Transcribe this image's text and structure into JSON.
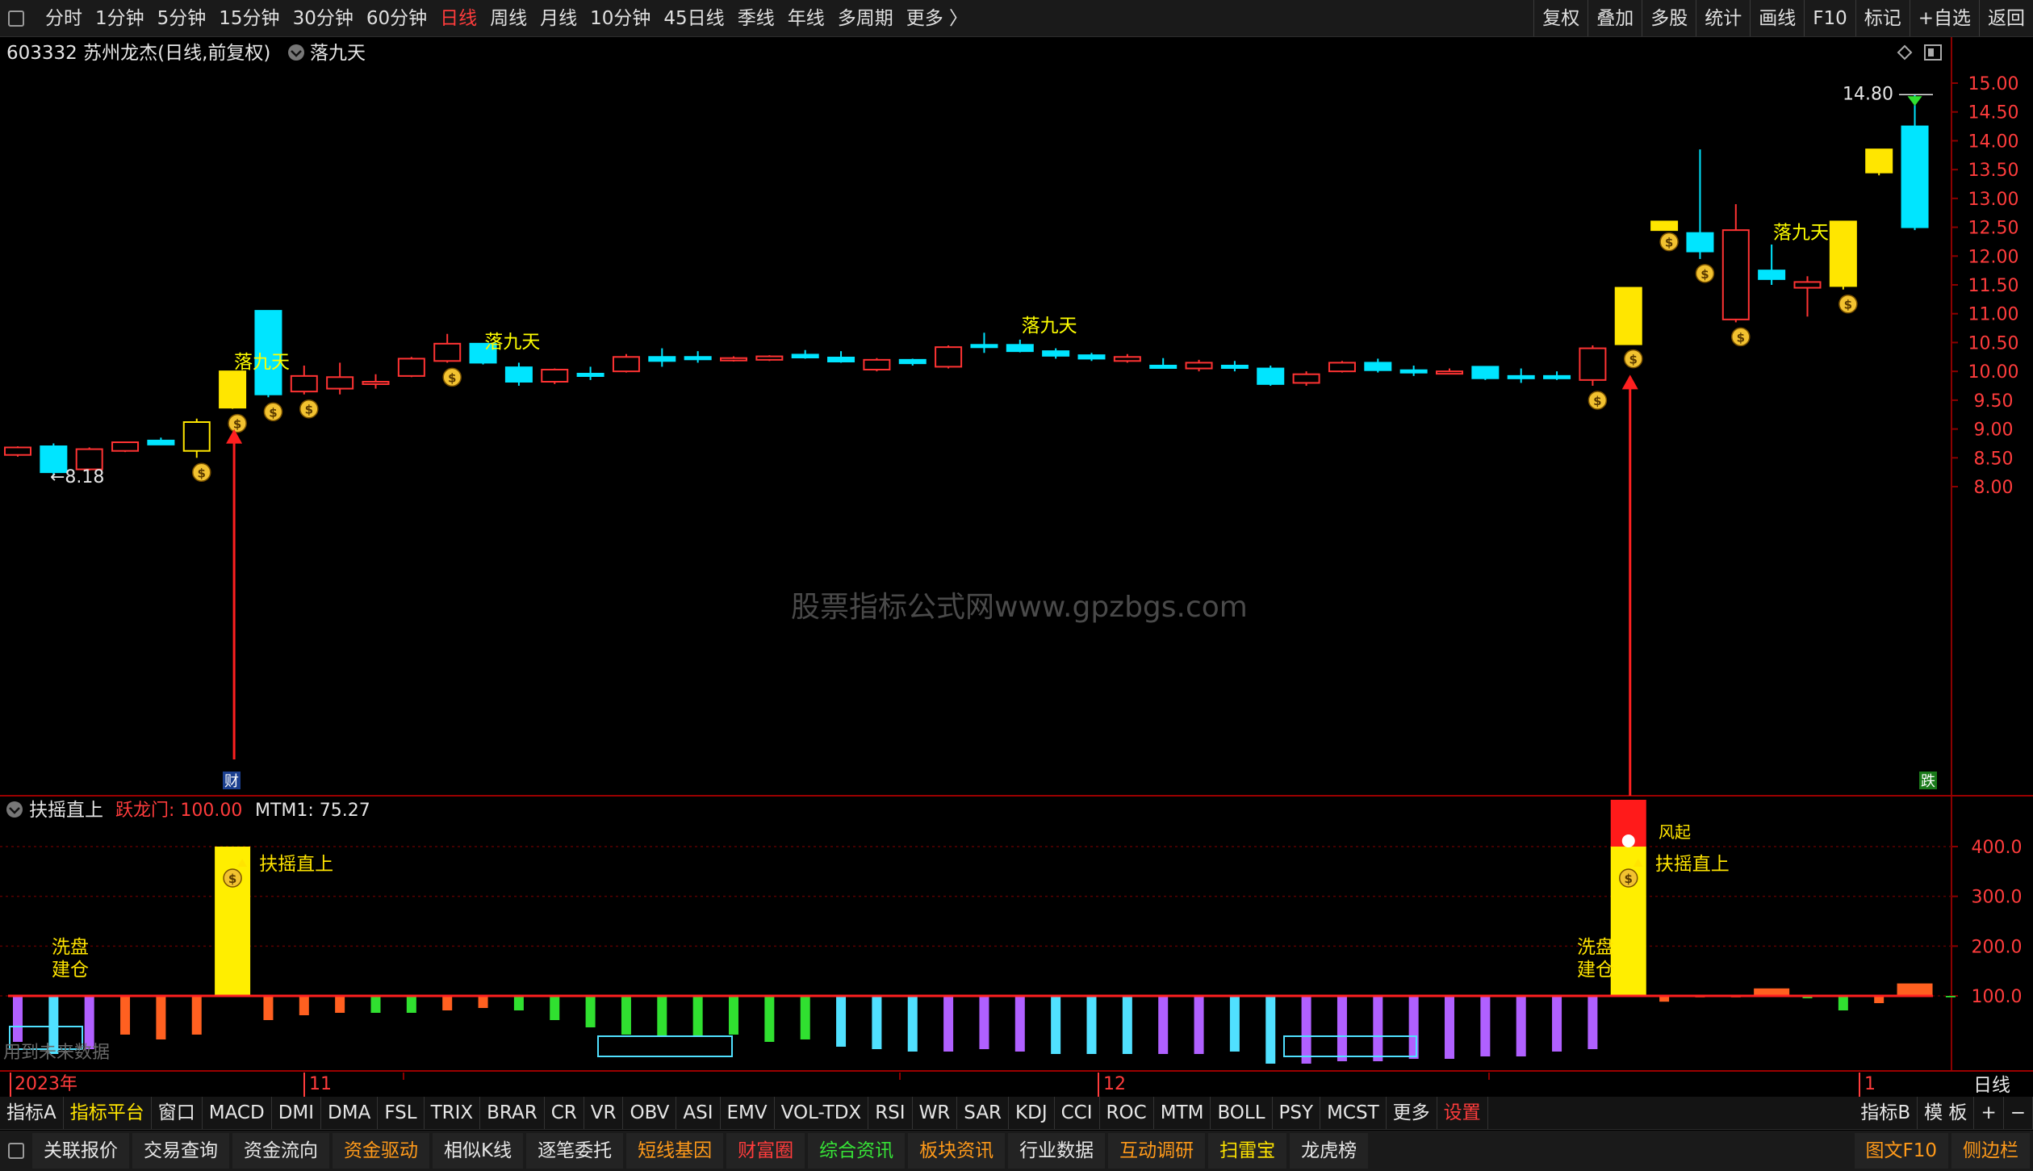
{
  "top_bar": {
    "periods": [
      "分时",
      "1分钟",
      "5分钟",
      "15分钟",
      "30分钟",
      "60分钟",
      "日线",
      "周线",
      "月线",
      "10分钟",
      "45日线",
      "季线",
      "年线",
      "多周期",
      "更多 〉"
    ],
    "active_period": "日线",
    "tools": [
      "复权",
      "叠加",
      "多股",
      "统计",
      "画线",
      "F10",
      "标记",
      "+自选",
      "返回"
    ]
  },
  "main_panel": {
    "stock_title": "603332 苏州龙杰(日线,前复权)",
    "indicator_name": "落九天",
    "price_axis": [
      "15.00",
      "14.50",
      "14.00",
      "13.50",
      "13.00",
      "12.50",
      "12.00",
      "11.50",
      "11.00",
      "10.50",
      "10.00",
      "9.50",
      "9.00",
      "8.50",
      "8.00"
    ],
    "watermark": "股票指标公式网www.gpzbgs.com",
    "low_label": "←8.18",
    "high_label": "14.80",
    "finance_marker": "财",
    "down_marker": "跌",
    "signal_text": "落九天",
    "colors": {
      "up": "#ff3333",
      "down": "#00e5ff",
      "signal": "#ffe600",
      "grid": "#8b0000",
      "text_signal": "#ffff00"
    }
  },
  "candles": [
    {
      "o": 8.55,
      "h": 8.7,
      "l": 8.52,
      "c": 8.68,
      "t": "up"
    },
    {
      "o": 8.7,
      "h": 8.75,
      "l": 8.2,
      "c": 8.25,
      "t": "down"
    },
    {
      "o": 8.3,
      "h": 8.68,
      "l": 8.28,
      "c": 8.65,
      "t": "up"
    },
    {
      "o": 8.62,
      "h": 8.78,
      "l": 8.6,
      "c": 8.77,
      "t": "up"
    },
    {
      "o": 8.8,
      "h": 8.85,
      "l": 8.72,
      "c": 8.73,
      "t": "down"
    },
    {
      "o": 8.62,
      "h": 9.18,
      "l": 8.5,
      "c": 9.12,
      "t": "signal_hollow"
    },
    {
      "o": 9.37,
      "h": 10.0,
      "l": 9.35,
      "c": 10.0,
      "t": "signal"
    },
    {
      "o": 9.6,
      "h": 11.05,
      "l": 9.55,
      "c": 11.05,
      "t": "down"
    },
    {
      "o": 9.65,
      "h": 10.1,
      "l": 9.6,
      "c": 9.92,
      "t": "up"
    },
    {
      "o": 9.7,
      "h": 10.15,
      "l": 9.6,
      "c": 9.9,
      "t": "up"
    },
    {
      "o": 9.78,
      "h": 9.95,
      "l": 9.7,
      "c": 9.82,
      "t": "up"
    },
    {
      "o": 9.92,
      "h": 10.25,
      "l": 9.9,
      "c": 10.22,
      "t": "up"
    },
    {
      "o": 10.18,
      "h": 10.65,
      "l": 10.15,
      "c": 10.48,
      "t": "up"
    },
    {
      "o": 10.48,
      "h": 10.48,
      "l": 10.12,
      "c": 10.15,
      "t": "down"
    },
    {
      "o": 10.07,
      "h": 10.15,
      "l": 9.75,
      "c": 9.82,
      "t": "down"
    },
    {
      "o": 9.82,
      "h": 10.05,
      "l": 9.78,
      "c": 10.03,
      "t": "up"
    },
    {
      "o": 9.96,
      "h": 10.08,
      "l": 9.85,
      "c": 9.96,
      "t": "down"
    },
    {
      "o": 10.0,
      "h": 10.3,
      "l": 9.98,
      "c": 10.25,
      "t": "up"
    },
    {
      "o": 10.25,
      "h": 10.4,
      "l": 10.08,
      "c": 10.18,
      "t": "down"
    },
    {
      "o": 10.25,
      "h": 10.35,
      "l": 10.15,
      "c": 10.22,
      "t": "down"
    },
    {
      "o": 10.19,
      "h": 10.26,
      "l": 10.17,
      "c": 10.23,
      "t": "up"
    },
    {
      "o": 10.2,
      "h": 10.28,
      "l": 10.18,
      "c": 10.26,
      "t": "up"
    },
    {
      "o": 10.29,
      "h": 10.37,
      "l": 10.22,
      "c": 10.24,
      "t": "down"
    },
    {
      "o": 10.24,
      "h": 10.35,
      "l": 10.15,
      "c": 10.17,
      "t": "down"
    },
    {
      "o": 10.03,
      "h": 10.23,
      "l": 10.0,
      "c": 10.2,
      "t": "up"
    },
    {
      "o": 10.2,
      "h": 10.22,
      "l": 10.1,
      "c": 10.14,
      "t": "down"
    },
    {
      "o": 10.08,
      "h": 10.45,
      "l": 10.05,
      "c": 10.42,
      "t": "up"
    },
    {
      "o": 10.46,
      "h": 10.67,
      "l": 10.32,
      "c": 10.46,
      "t": "down"
    },
    {
      "o": 10.46,
      "h": 10.55,
      "l": 10.33,
      "c": 10.35,
      "t": "down"
    },
    {
      "o": 10.35,
      "h": 10.4,
      "l": 10.22,
      "c": 10.27,
      "t": "down"
    },
    {
      "o": 10.28,
      "h": 10.32,
      "l": 10.18,
      "c": 10.22,
      "t": "down"
    },
    {
      "o": 10.18,
      "h": 10.3,
      "l": 10.15,
      "c": 10.25,
      "t": "up"
    },
    {
      "o": 10.1,
      "h": 10.23,
      "l": 10.05,
      "c": 10.08,
      "t": "down"
    },
    {
      "o": 10.05,
      "h": 10.2,
      "l": 10.0,
      "c": 10.15,
      "t": "up"
    },
    {
      "o": 10.1,
      "h": 10.18,
      "l": 10.0,
      "c": 10.08,
      "t": "down"
    },
    {
      "o": 10.05,
      "h": 10.1,
      "l": 9.75,
      "c": 9.78,
      "t": "down"
    },
    {
      "o": 9.8,
      "h": 10.0,
      "l": 9.75,
      "c": 9.95,
      "t": "up"
    },
    {
      "o": 10.0,
      "h": 10.18,
      "l": 9.98,
      "c": 10.15,
      "t": "up"
    },
    {
      "o": 10.15,
      "h": 10.22,
      "l": 9.98,
      "c": 10.02,
      "t": "down"
    },
    {
      "o": 10.02,
      "h": 10.1,
      "l": 9.92,
      "c": 9.98,
      "t": "down"
    },
    {
      "o": 9.98,
      "h": 10.05,
      "l": 9.95,
      "c": 10.0,
      "t": "up"
    },
    {
      "o": 10.08,
      "h": 10.08,
      "l": 9.85,
      "c": 9.88,
      "t": "down"
    },
    {
      "o": 9.92,
      "h": 10.05,
      "l": 9.8,
      "c": 9.92,
      "t": "down"
    },
    {
      "o": 9.88,
      "h": 10.0,
      "l": 9.85,
      "c": 9.92,
      "t": "down"
    },
    {
      "o": 9.85,
      "h": 10.45,
      "l": 9.75,
      "c": 10.4,
      "t": "up"
    },
    {
      "o": 10.47,
      "h": 11.45,
      "l": 10.47,
      "c": 11.45,
      "t": "signal"
    },
    {
      "o": 12.6,
      "h": 12.6,
      "l": 12.5,
      "c": 12.45,
      "t": "signal"
    },
    {
      "o": 12.4,
      "h": 13.85,
      "l": 11.95,
      "c": 12.08,
      "t": "down"
    },
    {
      "o": 10.9,
      "h": 12.9,
      "l": 10.85,
      "c": 12.45,
      "t": "up"
    },
    {
      "o": 11.75,
      "h": 12.2,
      "l": 11.5,
      "c": 11.6,
      "t": "down"
    },
    {
      "o": 11.45,
      "h": 11.65,
      "l": 10.95,
      "c": 11.55,
      "t": "up"
    },
    {
      "o": 11.48,
      "h": 12.6,
      "l": 11.42,
      "c": 12.6,
      "t": "signal"
    },
    {
      "o": 13.85,
      "h": 13.85,
      "l": 13.4,
      "c": 13.45,
      "t": "signal"
    },
    {
      "o": 14.25,
      "h": 14.8,
      "l": 12.45,
      "c": 12.5,
      "t": "down"
    }
  ],
  "lower_panel": {
    "indicator_title": "扶摇直上",
    "label_yuelongmen": "跃龙门: 100.00",
    "label_mtm": "MTM1: 75.27",
    "axis": [
      "400.0",
      "300.0",
      "200.0",
      "100.0"
    ],
    "signal_label": "扶摇直上",
    "wash_label_line1": "洗盘",
    "wash_label_line2": "建仓",
    "no_data_text": "用到未来数据",
    "wind_label": "风起"
  },
  "lower_bars": [
    {
      "v": -95,
      "c": "#b060ff"
    },
    {
      "v": -120,
      "c": "#50e0ff"
    },
    {
      "v": -110,
      "c": "#b060ff"
    },
    {
      "v": -80,
      "c": "#ff6020"
    },
    {
      "v": -90,
      "c": "#ff6020"
    },
    {
      "v": -80,
      "c": "#ff6020"
    },
    {
      "v": 300,
      "c": "#ffee00"
    },
    {
      "v": -50,
      "c": "#ff6020"
    },
    {
      "v": -40,
      "c": "#ff6020"
    },
    {
      "v": -35,
      "c": "#ff6020"
    },
    {
      "v": -35,
      "c": "#30e030"
    },
    {
      "v": -35,
      "c": "#30e030"
    },
    {
      "v": -30,
      "c": "#ff6020"
    },
    {
      "v": -25,
      "c": "#ff6020"
    },
    {
      "v": -30,
      "c": "#30e030"
    },
    {
      "v": -50,
      "c": "#30e030"
    },
    {
      "v": -65,
      "c": "#30e030"
    },
    {
      "v": -80,
      "c": "#30e030"
    },
    {
      "v": -85,
      "c": "#30e030"
    },
    {
      "v": -85,
      "c": "#30e030"
    },
    {
      "v": -80,
      "c": "#30e030"
    },
    {
      "v": -95,
      "c": "#30e030"
    },
    {
      "v": -90,
      "c": "#30e030"
    },
    {
      "v": -105,
      "c": "#50e0ff"
    },
    {
      "v": -110,
      "c": "#50e0ff"
    },
    {
      "v": -115,
      "c": "#50e0ff"
    },
    {
      "v": -115,
      "c": "#b060ff"
    },
    {
      "v": -110,
      "c": "#b060ff"
    },
    {
      "v": -115,
      "c": "#b060ff"
    },
    {
      "v": -120,
      "c": "#50e0ff"
    },
    {
      "v": -120,
      "c": "#50e0ff"
    },
    {
      "v": -120,
      "c": "#50e0ff"
    },
    {
      "v": -120,
      "c": "#b060ff"
    },
    {
      "v": -120,
      "c": "#b060ff"
    },
    {
      "v": -115,
      "c": "#50e0ff"
    },
    {
      "v": -140,
      "c": "#50e0ff"
    },
    {
      "v": -140,
      "c": "#b060ff"
    },
    {
      "v": -135,
      "c": "#b060ff"
    },
    {
      "v": -135,
      "c": "#b060ff"
    },
    {
      "v": -130,
      "c": "#b060ff"
    },
    {
      "v": -130,
      "c": "#b060ff"
    },
    {
      "v": -125,
      "c": "#b060ff"
    },
    {
      "v": -125,
      "c": "#b060ff"
    },
    {
      "v": -115,
      "c": "#b060ff"
    },
    {
      "v": -110,
      "c": "#b060ff"
    },
    {
      "v": 300,
      "c": "#ffee00",
      "top": "#ff1a1a"
    },
    {
      "v": -12,
      "c": "#ff6020"
    },
    {
      "v": -3,
      "c": "#ff6020"
    },
    {
      "v": -3,
      "c": "#ff6020"
    },
    {
      "v": 15,
      "c": "#ff6020"
    },
    {
      "v": -5,
      "c": "#30e030"
    },
    {
      "v": -30,
      "c": "#30e030"
    },
    {
      "v": -15,
      "c": "#ff6020"
    },
    {
      "v": 25,
      "c": "#ff6020"
    },
    {
      "v": -3,
      "c": "#30e030"
    }
  ],
  "date_axis": {
    "year_label": "2023年",
    "labels": [
      "11",
      "12",
      "1"
    ],
    "period_label": "日线"
  },
  "indicator_bar": {
    "tabs": [
      "指标A",
      "指标平台",
      "窗口",
      "MACD",
      "DMI",
      "DMA",
      "FSL",
      "TRIX",
      "BRAR",
      "CR",
      "VR",
      "OBV",
      "ASI",
      "EMV",
      "VOL-TDX",
      "RSI",
      "WR",
      "SAR",
      "KDJ",
      "CCI",
      "ROC",
      "MTM",
      "BOLL",
      "PSY",
      "MCST",
      "更多",
      "设置"
    ],
    "right": [
      "指标B",
      "模 板",
      "+",
      "−"
    ]
  },
  "function_bar": {
    "tabs": [
      "关联报价",
      "交易查询",
      "资金流向",
      "资金驱动",
      "相似K线",
      "逐笔委托",
      "短线基因",
      "财富圈",
      "综合资讯",
      "板块资讯",
      "行业数据",
      "互动调研",
      "扫雷宝",
      "龙虎榜"
    ],
    "right": [
      "图文F10",
      "侧边栏"
    ]
  }
}
